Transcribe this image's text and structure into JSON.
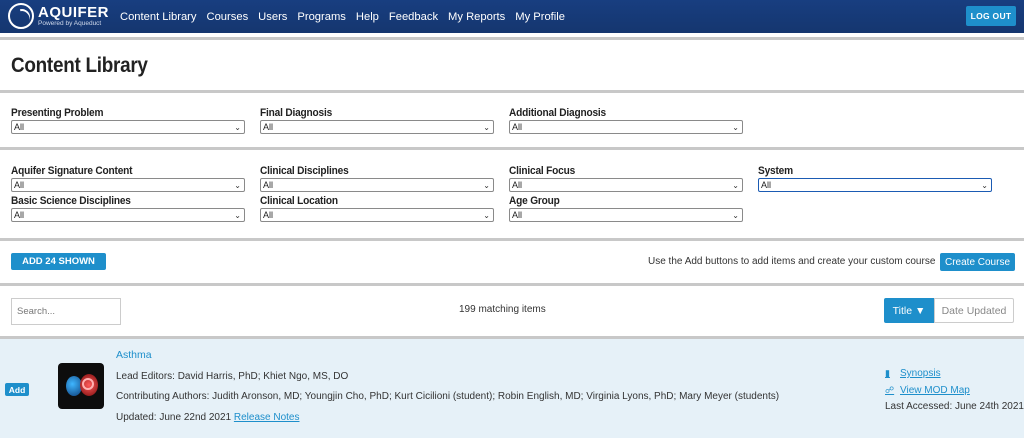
{
  "nav": {
    "logo_name": "AQUIFER",
    "logo_sub": "Powered by Aqueduct",
    "links": [
      "Content Library",
      "Courses",
      "Users",
      "Programs",
      "Help",
      "Feedback",
      "My Reports",
      "My Profile"
    ],
    "logout": "LOG OUT"
  },
  "page_title": "Content Library",
  "filters_row1": [
    {
      "label": "Presenting Problem",
      "value": "All"
    },
    {
      "label": "Final Diagnosis",
      "value": "All"
    },
    {
      "label": "Additional Diagnosis",
      "value": "All"
    }
  ],
  "filters_row2": [
    {
      "label": "Aquifer Signature Content",
      "value": "All"
    },
    {
      "label": "Clinical Disciplines",
      "value": "All"
    },
    {
      "label": "Clinical Focus",
      "value": "All"
    },
    {
      "label": "System",
      "value": "All"
    }
  ],
  "filters_row3": [
    {
      "label": "Basic Science Disciplines",
      "value": "All"
    },
    {
      "label": "Clinical Location",
      "value": "All"
    },
    {
      "label": "Age Group",
      "value": "All"
    }
  ],
  "actions": {
    "add_shown": "ADD 24 SHOWN",
    "hint": "Use the Add buttons to add items and create your custom course",
    "create_course": "Create Course"
  },
  "list_controls": {
    "search_placeholder": "Search...",
    "matching": "199 matching items",
    "sort_title": "Title ▼",
    "sort_date": "Date Updated"
  },
  "item": {
    "add": "Add",
    "title": "Asthma",
    "lead_editors": "Lead Editors: David Harris, PhD; Khiet Ngo, MS, DO",
    "contributing": "Contributing Authors: Judith Aronson, MD; Youngjin Cho, PhD; Kurt Cicilioni (student); Robin English, MD; Virginia Lyons, PhD; Mary Meyer (students)",
    "updated": "Updated: June 22nd 2021",
    "release_notes": "Release Notes",
    "synopsis": "Synopsis",
    "mod_map": "View MOD Map",
    "last_accessed": "Last Accessed: June 24th 2021"
  }
}
